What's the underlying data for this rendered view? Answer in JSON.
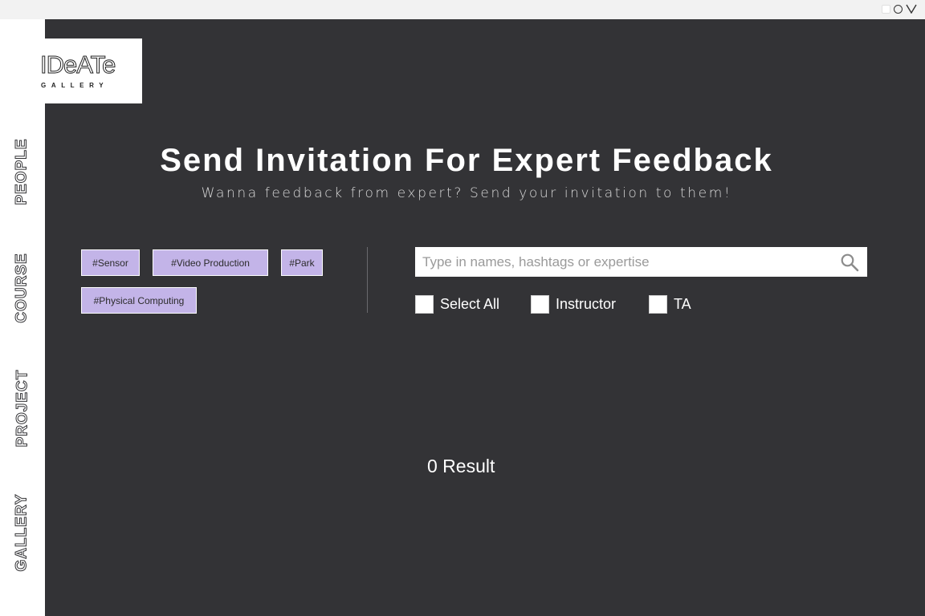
{
  "sidebar": {
    "items": [
      {
        "label": "PEOPLE"
      },
      {
        "label": "COURSE"
      },
      {
        "label": "PROJECT"
      },
      {
        "label": "GALLERY"
      }
    ]
  },
  "logo": {
    "word": "IDeATe",
    "sub": "GALLERY"
  },
  "header": {
    "title": "Send Invitation For Expert Feedback",
    "subtitle": "Wanna feedback from expert? Send your invitation to them!"
  },
  "tags": [
    "#Sensor",
    "#Video Production",
    "#Park",
    "#Physical Computing"
  ],
  "search": {
    "placeholder": "Type in names, hashtags or expertise",
    "value": ""
  },
  "filters": [
    {
      "label": "Select All",
      "checked": false
    },
    {
      "label": "Instructor",
      "checked": false
    },
    {
      "label": "TA",
      "checked": false
    }
  ],
  "results": {
    "label": "0 Result"
  },
  "colors": {
    "background": "#333336",
    "tag": "#c3b4e8",
    "text": "#ffffff"
  }
}
